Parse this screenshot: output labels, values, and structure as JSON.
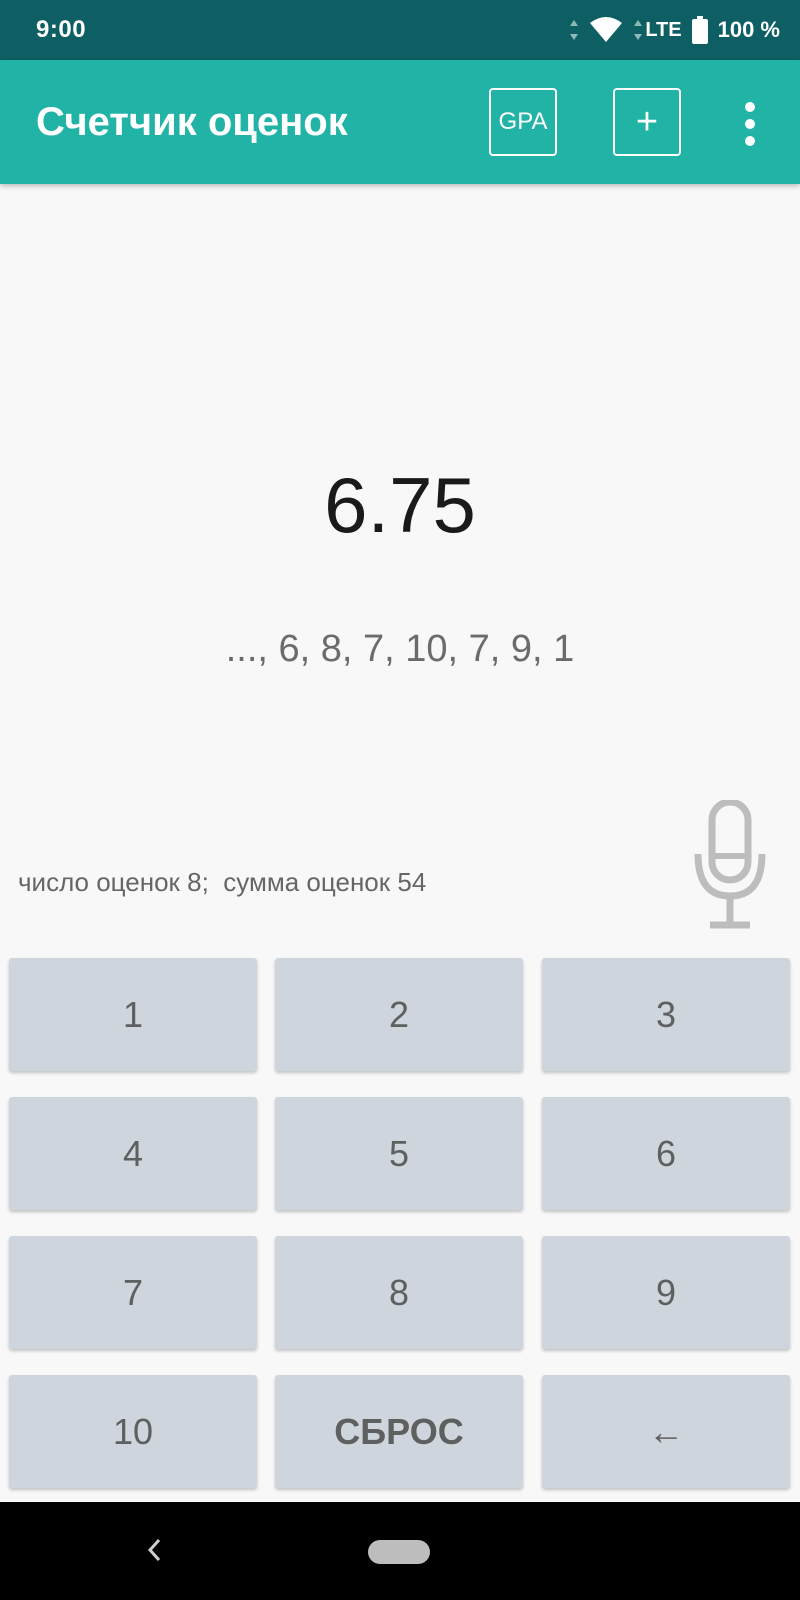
{
  "status_bar": {
    "time": "9:00",
    "network": "LTE",
    "battery": "100 %"
  },
  "app_bar": {
    "title": "Счетчик оценок",
    "gpa_label": "GPA",
    "add_label": "+"
  },
  "main": {
    "average": "6.75",
    "grades": "..., 6, 8, 7, 10, 7, 9, 1",
    "stats": "число оценок 8;  сумма оценок 54"
  },
  "keypad": {
    "k1": "1",
    "k2": "2",
    "k3": "3",
    "k4": "4",
    "k5": "5",
    "k6": "6",
    "k7": "7",
    "k8": "8",
    "k9": "9",
    "k10": "10",
    "reset": "СБРОС",
    "backspace": "←"
  },
  "colors": {
    "status_bar": "#0e5f63",
    "app_bar": "#20b3a6",
    "key_bg": "#cfd5dc",
    "key_text": "#5e605f"
  },
  "icons": {
    "status": [
      "signal-icon",
      "wifi-icon",
      "lte-icon",
      "battery-icon"
    ],
    "app_bar": [
      "more-vert-icon"
    ],
    "main": [
      "microphone-icon"
    ],
    "nav": [
      "back-icon",
      "home-pill-icon"
    ]
  }
}
